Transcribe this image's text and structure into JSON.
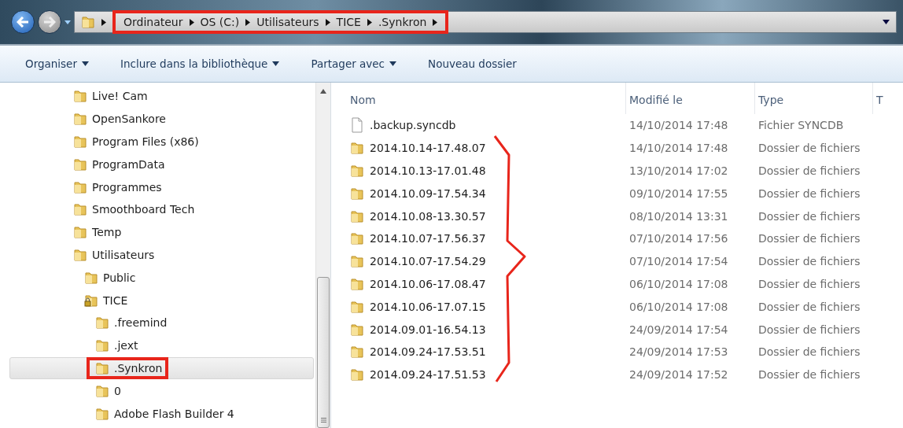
{
  "address_bar": {
    "highlighted": true,
    "crumbs": [
      "Ordinateur",
      "OS (C:)",
      "Utilisateurs",
      "TICE",
      ".Synkron"
    ]
  },
  "toolbar": {
    "items": [
      {
        "label": "Organiser",
        "dropdown": true
      },
      {
        "label": "Inclure dans la bibliothèque",
        "dropdown": true
      },
      {
        "label": "Partager avec",
        "dropdown": true
      },
      {
        "label": "Nouveau dossier",
        "dropdown": false
      }
    ]
  },
  "sidebar": {
    "items": [
      {
        "label": "Live! Cam",
        "kind": "folder",
        "selected": false,
        "highlighted": false
      },
      {
        "label": "OpenSankore",
        "kind": "folder",
        "selected": false,
        "highlighted": false
      },
      {
        "label": "Program Files (x86)",
        "kind": "folder",
        "selected": false,
        "highlighted": false
      },
      {
        "label": "ProgramData",
        "kind": "folder",
        "selected": false,
        "highlighted": false
      },
      {
        "label": "Programmes",
        "kind": "folder",
        "selected": false,
        "highlighted": false
      },
      {
        "label": "Smoothboard Tech",
        "kind": "folder",
        "selected": false,
        "highlighted": false
      },
      {
        "label": "Temp",
        "kind": "folder",
        "selected": false,
        "highlighted": false
      },
      {
        "label": "Utilisateurs",
        "kind": "folder",
        "selected": false,
        "highlighted": false,
        "children": [
          {
            "label": "Public",
            "kind": "folder",
            "selected": false,
            "highlighted": false
          },
          {
            "label": "TICE",
            "kind": "locked",
            "selected": false,
            "highlighted": false,
            "children": [
              {
                "label": ".freemind",
                "kind": "folder",
                "selected": false,
                "highlighted": false
              },
              {
                "label": ".jext",
                "kind": "folder",
                "selected": false,
                "highlighted": false
              },
              {
                "label": ".Synkron",
                "kind": "folder",
                "selected": true,
                "highlighted": true
              },
              {
                "label": "0",
                "kind": "folder",
                "selected": false,
                "highlighted": false
              },
              {
                "label": "Adobe Flash Builder 4",
                "kind": "folder",
                "selected": false,
                "highlighted": false
              }
            ]
          }
        ]
      }
    ]
  },
  "file_list": {
    "columns": [
      "Nom",
      "Modifié le",
      "Type",
      "T"
    ],
    "rows": [
      {
        "kind": "file",
        "name": ".backup.syncdb",
        "modified": "14/10/2014 17:48",
        "type": "Fichier SYNCDB"
      },
      {
        "kind": "folder",
        "name": "2014.10.14-17.48.07",
        "modified": "14/10/2014 17:48",
        "type": "Dossier de fichiers"
      },
      {
        "kind": "folder",
        "name": "2014.10.13-17.01.48",
        "modified": "13/10/2014 17:02",
        "type": "Dossier de fichiers"
      },
      {
        "kind": "folder",
        "name": "2014.10.09-17.54.34",
        "modified": "09/10/2014 17:55",
        "type": "Dossier de fichiers"
      },
      {
        "kind": "folder",
        "name": "2014.10.08-13.30.57",
        "modified": "08/10/2014 13:31",
        "type": "Dossier de fichiers"
      },
      {
        "kind": "folder",
        "name": "2014.10.07-17.56.37",
        "modified": "07/10/2014 17:56",
        "type": "Dossier de fichiers"
      },
      {
        "kind": "folder",
        "name": "2014.10.07-17.54.29",
        "modified": "07/10/2014 17:54",
        "type": "Dossier de fichiers"
      },
      {
        "kind": "folder",
        "name": "2014.10.06-17.08.47",
        "modified": "06/10/2014 17:08",
        "type": "Dossier de fichiers"
      },
      {
        "kind": "folder",
        "name": "2014.10.06-17.07.15",
        "modified": "06/10/2014 17:08",
        "type": "Dossier de fichiers"
      },
      {
        "kind": "folder",
        "name": "2014.09.01-16.54.13",
        "modified": "24/09/2014 17:54",
        "type": "Dossier de fichiers"
      },
      {
        "kind": "folder",
        "name": "2014.09.24-17.53.51",
        "modified": "24/09/2014 17:53",
        "type": "Dossier de fichiers"
      },
      {
        "kind": "folder",
        "name": "2014.09.24-17.51.53",
        "modified": "24/09/2014 17:52",
        "type": "Dossier de fichiers"
      }
    ]
  }
}
